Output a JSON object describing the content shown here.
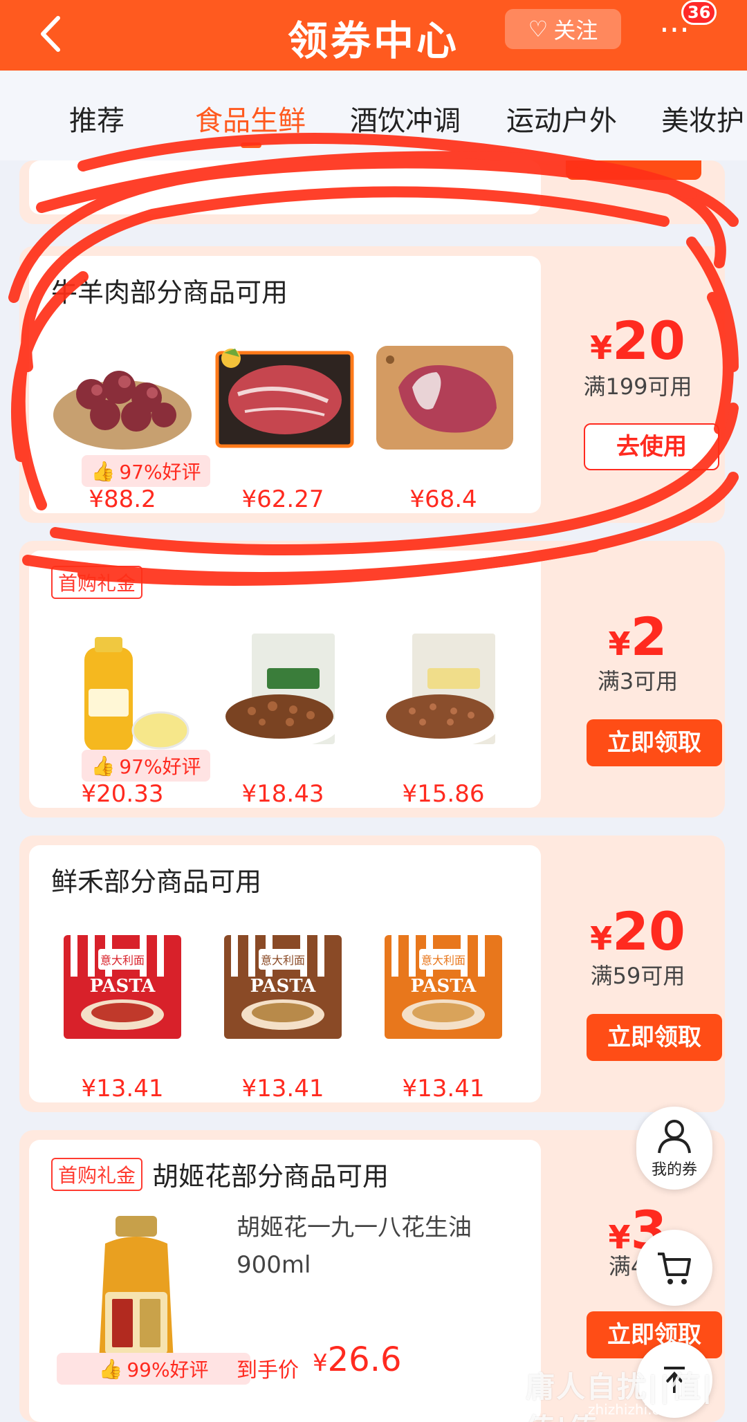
{
  "header": {
    "title": "领券中心",
    "follow_label": "关注",
    "more_badge": "36"
  },
  "tabs": [
    "推荐",
    "食品生鲜",
    "酒饮冲调",
    "运动户外",
    "美妆护"
  ],
  "active_tab": "食品生鲜",
  "cards": [
    {
      "title": "牛羊肉部分商品可用",
      "tag": "",
      "products": [
        {
          "name": "牛肉粒",
          "price": "¥88.2",
          "rating": "97%好评"
        },
        {
          "name": "牛排肉块",
          "price": "¥62.27"
        },
        {
          "name": "羊肉块",
          "price": "¥68.4"
        }
      ],
      "amount_yen": "¥",
      "amount": "20",
      "condition": "满199可用",
      "button": "去使用"
    },
    {
      "title": "",
      "tag": "首购礼金",
      "products": [
        {
          "name": "蜂蜜",
          "price": "¥20.33",
          "rating": "97%好评"
        },
        {
          "name": "碧根果碎仁",
          "price": "¥18.43"
        },
        {
          "name": "山核桃碎仁",
          "price": "¥15.86"
        }
      ],
      "amount_yen": "¥",
      "amount": "2",
      "condition": "满3可用",
      "button": "立即领取"
    },
    {
      "title": "鲜禾部分商品可用",
      "tag": "",
      "products": [
        {
          "name": "意大利面",
          "price": "¥13.41",
          "pack_text": "意大利面",
          "pack_sub": "PASTA"
        },
        {
          "name": "意大利面",
          "price": "¥13.41",
          "pack_text": "意大利面",
          "pack_sub": "PASTA"
        },
        {
          "name": "意大利面",
          "price": "¥13.41",
          "pack_text": "意大利面",
          "pack_sub": "PASTA"
        }
      ],
      "amount_yen": "¥",
      "amount": "20",
      "condition": "满59可用",
      "button": "立即领取"
    },
    {
      "title": "胡姬花部分商品可用",
      "tag": "首购礼金",
      "product_name": "胡姬花一九一八花生油900ml",
      "rating": "99%好评",
      "final_price_label": "到手价",
      "final_price_yen": "¥",
      "final_price": "26.6",
      "amount_yen": "¥",
      "amount": "3",
      "condition": "满4可",
      "button": "立即领取"
    }
  ],
  "floating": {
    "my_coupons": "我的券"
  },
  "watermark": "庸人自扰||值|值|值",
  "watermark_sub": "zhizhizhi.com",
  "colors": {
    "brand": "#ff5a1f",
    "price": "#ff2a1f",
    "scribble": "#ff3018"
  }
}
